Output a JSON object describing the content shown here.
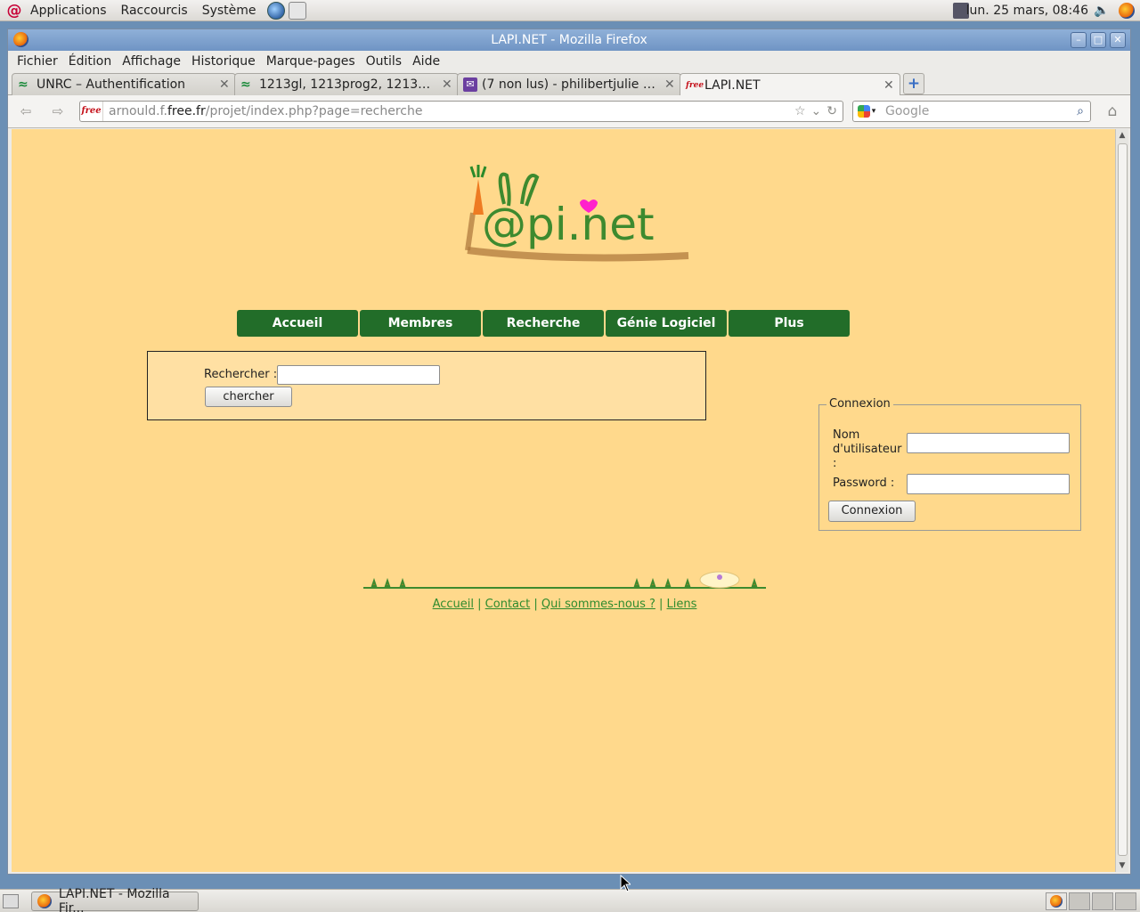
{
  "top_panel": {
    "menus": [
      "Applications",
      "Raccourcis",
      "Système"
    ],
    "clock": "lun. 25 mars, 08:46"
  },
  "window": {
    "title": "LAPI.NET - Mozilla Firefox",
    "menubar": [
      "Fichier",
      "Édition",
      "Affichage",
      "Historique",
      "Marque-pages",
      "Outils",
      "Aide"
    ],
    "tabs": [
      {
        "title": "UNRC – Authentification",
        "active": false
      },
      {
        "title": "1213gl, 1213prog2, 1213web...",
        "active": false
      },
      {
        "title": "(7 non lus) - philibertjulie - Ya...",
        "active": false
      },
      {
        "title": "LAPI.NET",
        "active": true
      }
    ],
    "url": {
      "prefix": "arnould.f.",
      "domain": "free.fr",
      "path": "/projet/index.php?page=recherche"
    },
    "search_placeholder": "Google",
    "url_favicon": "free"
  },
  "page": {
    "nav": [
      "Accueil",
      "Membres",
      "Recherche",
      "Génie Logiciel",
      "Plus"
    ],
    "search": {
      "label": "Rechercher :",
      "button": "chercher",
      "value": ""
    },
    "login": {
      "legend": "Connexion",
      "user_label": "Nom d'utilisateur :",
      "password_label": "Password :",
      "button": "Connexion"
    },
    "footer_links": [
      "Accueil",
      "Contact",
      "Qui sommes-nous ?",
      "Liens"
    ],
    "logo_text": "@pi.net",
    "colors": {
      "page_bg": "#ffd98c",
      "nav_bg": "#226d29",
      "link": "#2e8b2e"
    }
  },
  "taskbar": {
    "task_label": "LAPI.NET - Mozilla Fir..."
  }
}
